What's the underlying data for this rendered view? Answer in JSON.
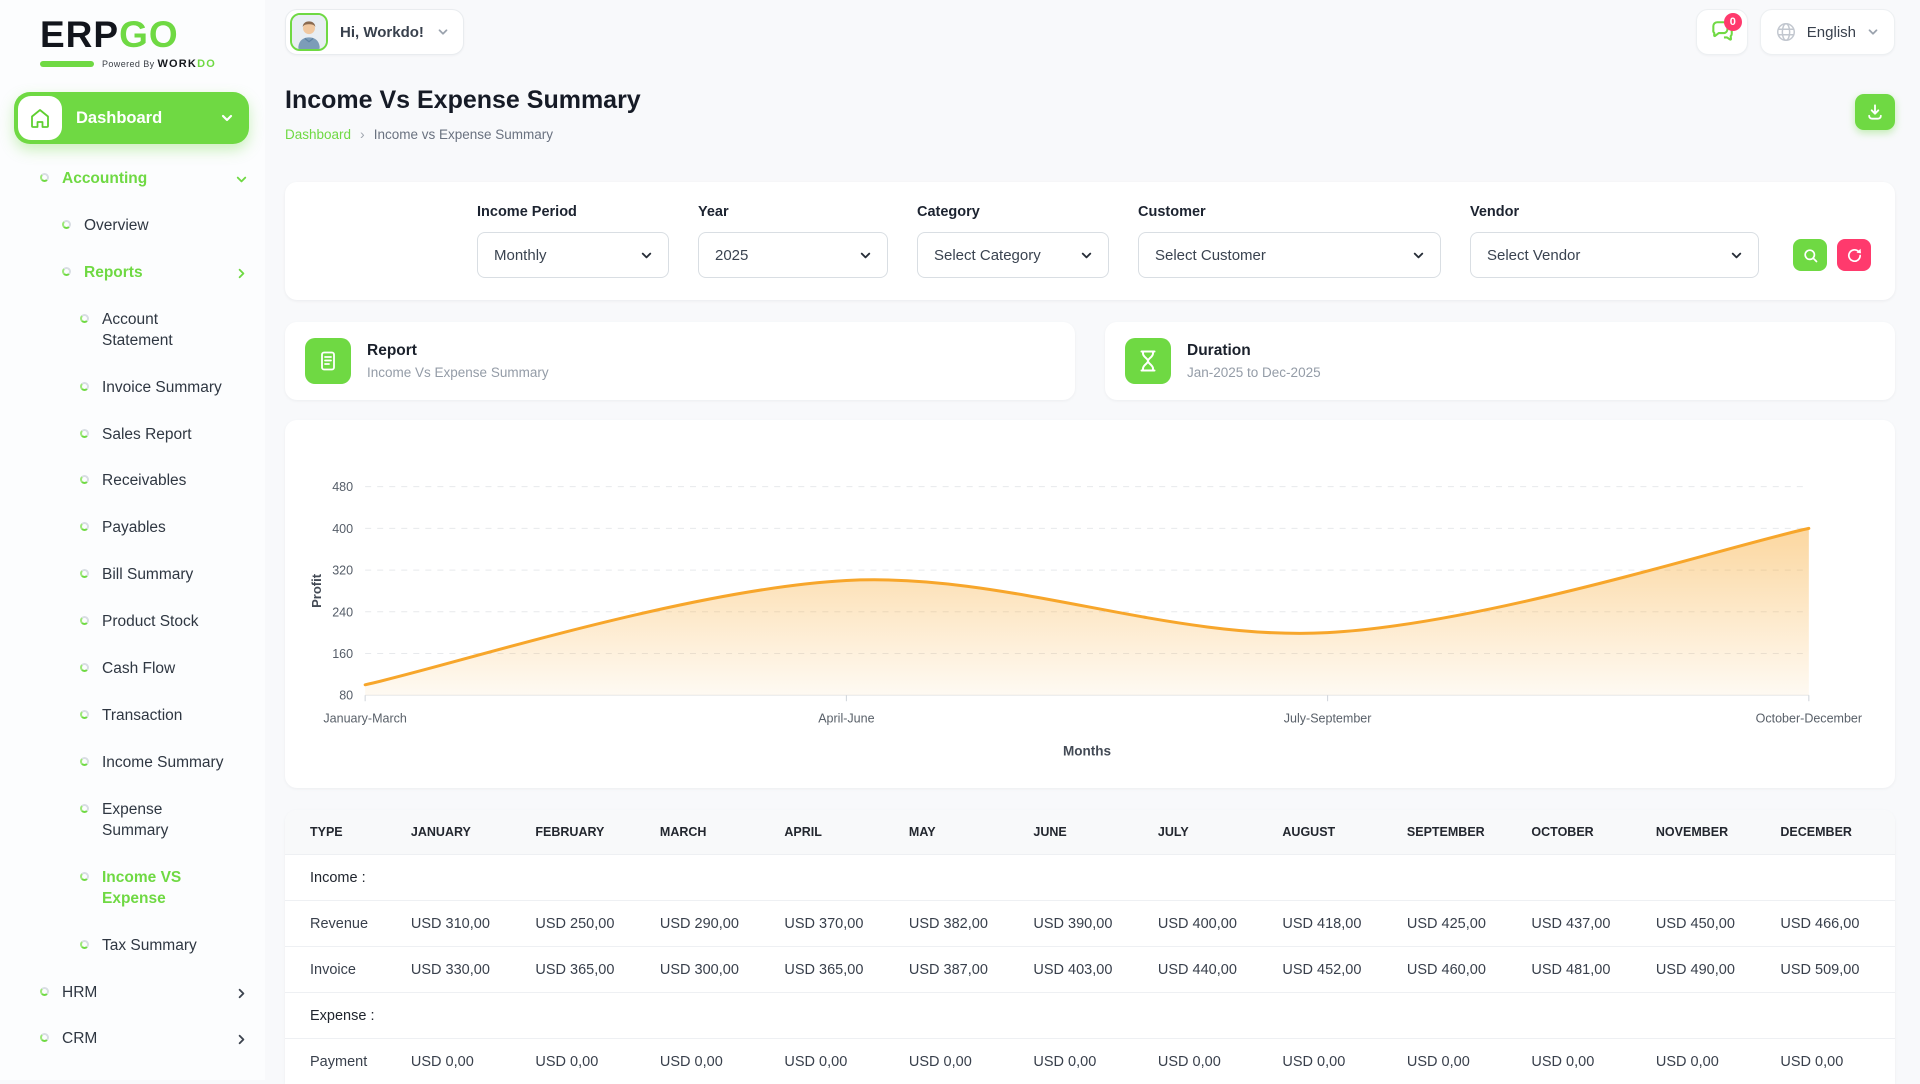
{
  "brand": {
    "name_primary": "ERP",
    "name_secondary": "GO",
    "tagline_prefix": "Powered By",
    "tagline_word1": "WORK",
    "tagline_word2": "DO"
  },
  "topbar": {
    "greeting": "Hi, Workdo!",
    "notification_count": "0",
    "language": "English"
  },
  "page": {
    "title": "Income Vs Expense Summary",
    "breadcrumb_home": "Dashboard",
    "breadcrumb_current": "Income vs Expense Summary"
  },
  "sidebar": {
    "dashboard_label": "Dashboard",
    "items": [
      {
        "label": "Accounting",
        "level": 1,
        "emphasis": true,
        "chevron": "down"
      },
      {
        "label": "Overview",
        "level": 2
      },
      {
        "label": "Reports",
        "level": 2,
        "emphasis": true,
        "chevron": "right"
      },
      {
        "label": "Account Statement",
        "level": 3
      },
      {
        "label": "Invoice Summary",
        "level": 3
      },
      {
        "label": "Sales Report",
        "level": 3
      },
      {
        "label": "Receivables",
        "level": 3
      },
      {
        "label": "Payables",
        "level": 3
      },
      {
        "label": "Bill Summary",
        "level": 3
      },
      {
        "label": "Product Stock",
        "level": 3
      },
      {
        "label": "Cash Flow",
        "level": 3
      },
      {
        "label": "Transaction",
        "level": 3
      },
      {
        "label": "Income Summary",
        "level": 3
      },
      {
        "label": "Expense Summary",
        "level": 3
      },
      {
        "label": "Income VS Expense",
        "level": 3,
        "active": true
      },
      {
        "label": "Tax Summary",
        "level": 3
      },
      {
        "label": "HRM",
        "level": 1,
        "chevron": "right"
      },
      {
        "label": "CRM",
        "level": 1,
        "chevron": "right"
      }
    ]
  },
  "filters": {
    "fields": [
      {
        "label": "Income Period",
        "value": "Monthly"
      },
      {
        "label": "Year",
        "value": "2025"
      },
      {
        "label": "Category",
        "value": "Select Category"
      },
      {
        "label": "Customer",
        "value": "Select Customer"
      },
      {
        "label": "Vendor",
        "value": "Select Vendor"
      }
    ]
  },
  "summary_cards": [
    {
      "title": "Report",
      "subtitle": "Income Vs Expense Summary",
      "icon": "document-icon"
    },
    {
      "title": "Duration",
      "subtitle": "Jan-2025 to Dec-2025",
      "icon": "hourglass-icon"
    }
  ],
  "chart_data": {
    "type": "area",
    "categories": [
      "January-March",
      "April-June",
      "July-September",
      "October-December"
    ],
    "series": [
      {
        "name": "Profit",
        "values": [
          100,
          300,
          200,
          400
        ]
      }
    ],
    "xlabel": "Months",
    "ylabel": "Profit",
    "ylim": [
      80,
      500
    ],
    "yticks": [
      80,
      160,
      240,
      320,
      400,
      480
    ],
    "grid": "dashed-horizontal",
    "legend": "none",
    "line_color": "#F7A62B",
    "fill": "gradient-orange"
  },
  "table": {
    "headers": [
      "TYPE",
      "JANUARY",
      "FEBRUARY",
      "MARCH",
      "APRIL",
      "MAY",
      "JUNE",
      "JULY",
      "AUGUST",
      "SEPTEMBER",
      "OCTOBER",
      "NOVEMBER",
      "DECEMBER"
    ],
    "rows": [
      {
        "kind": "section",
        "label": "Income :"
      },
      {
        "kind": "data",
        "label": "Revenue",
        "values": [
          "USD 310,00",
          "USD 250,00",
          "USD 290,00",
          "USD 370,00",
          "USD 382,00",
          "USD 390,00",
          "USD 400,00",
          "USD 418,00",
          "USD 425,00",
          "USD 437,00",
          "USD 450,00",
          "USD 466,00"
        ]
      },
      {
        "kind": "data",
        "label": "Invoice",
        "values": [
          "USD 330,00",
          "USD 365,00",
          "USD 300,00",
          "USD 365,00",
          "USD 387,00",
          "USD 403,00",
          "USD 440,00",
          "USD 452,00",
          "USD 460,00",
          "USD 481,00",
          "USD 490,00",
          "USD 509,00"
        ]
      },
      {
        "kind": "section",
        "label": "Expense :"
      },
      {
        "kind": "data",
        "label": "Payment",
        "values": [
          "USD 0,00",
          "USD 0,00",
          "USD 0,00",
          "USD 0,00",
          "USD 0,00",
          "USD 0,00",
          "USD 0,00",
          "USD 0,00",
          "USD 0,00",
          "USD 0,00",
          "USD 0,00",
          "USD 0,00"
        ]
      }
    ]
  },
  "colors": {
    "primary_green": "#6FD943",
    "accent_pink": "#FF3A6D",
    "chart_orange": "#F7A62B",
    "text_dark": "#1F2937",
    "text_muted": "#6A7280"
  }
}
